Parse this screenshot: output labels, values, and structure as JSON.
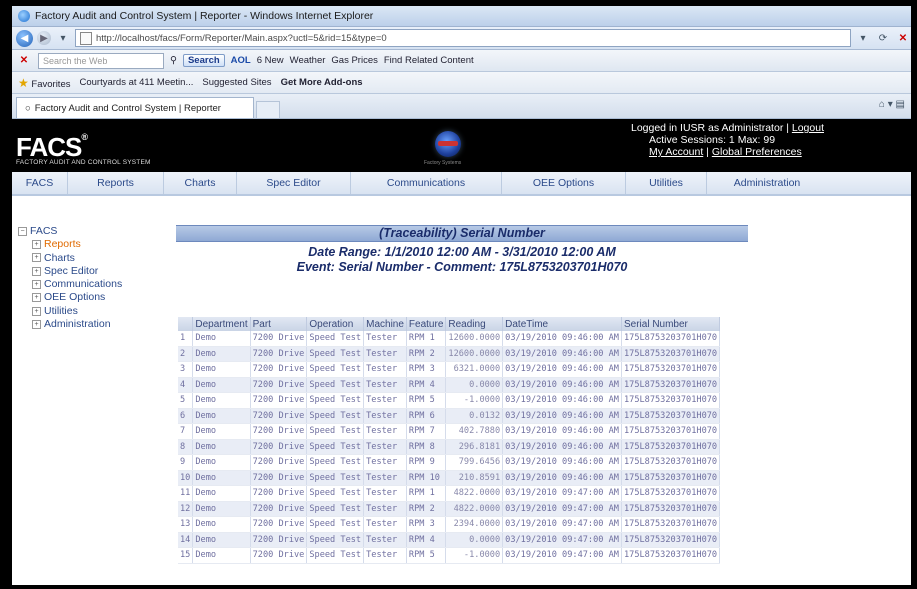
{
  "browser": {
    "title": "Factory Audit and Control System | Reporter - Windows Internet Explorer",
    "url": "http://localhost/facs/Form/Reporter/Main.aspx?uctl=5&rid=15&type=0",
    "search_placeholder": "Search the Web",
    "search_button": "Search",
    "toolbar_items": [
      "AOL",
      "6 New",
      "Weather",
      "Gas Prices",
      "Find Related Content"
    ],
    "favorites_label": "Favorites",
    "favorites_items": [
      "Courtyards at 411 Meetin...",
      "Suggested Sites",
      "Get More Add-ons"
    ],
    "tab_title": "Factory Audit and Control System | Reporter"
  },
  "header": {
    "logo": "FACS",
    "logo_mark": "®",
    "logo_sub": "FACTORY AUDIT AND CONTROL SYSTEM",
    "globe_caption": "Factory Systems",
    "login_prefix": "Logged in IUSR as Administrator | ",
    "logout": "Logout",
    "sessions": "Active Sessions: 1 Max: 99",
    "my_account": "My Account",
    "separator": " | ",
    "global_prefs": "Global Preferences"
  },
  "menu": [
    "FACS",
    "Reports",
    "Charts",
    "Spec Editor",
    "Communications",
    "OEE Options",
    "Utilities",
    "Administration"
  ],
  "tree": {
    "root": "FACS",
    "items": [
      "Reports",
      "Charts",
      "Spec Editor",
      "Communications",
      "OEE Options",
      "Utilities",
      "Administration"
    ]
  },
  "report": {
    "title": "(Traceability) Serial Number",
    "date_range": "Date Range: 1/1/2010 12:00 AM - 3/31/2010 12:00 AM",
    "event": "Event: Serial Number - Comment: 175L8753203701H070"
  },
  "table": {
    "columns": [
      "",
      "Department",
      "Part",
      "Operation",
      "Machine",
      "Feature",
      "Reading",
      "DateTime",
      "Serial Number"
    ],
    "rows": [
      [
        "1",
        "Demo",
        "7200 Drive",
        "Speed Test",
        "Tester",
        "RPM 1",
        "12600.0000",
        "03/19/2010 09:46:00 AM",
        "175L8753203701H070"
      ],
      [
        "2",
        "Demo",
        "7200 Drive",
        "Speed Test",
        "Tester",
        "RPM 2",
        "12600.0000",
        "03/19/2010 09:46:00 AM",
        "175L8753203701H070"
      ],
      [
        "3",
        "Demo",
        "7200 Drive",
        "Speed Test",
        "Tester",
        "RPM 3",
        "6321.0000",
        "03/19/2010 09:46:00 AM",
        "175L8753203701H070"
      ],
      [
        "4",
        "Demo",
        "7200 Drive",
        "Speed Test",
        "Tester",
        "RPM 4",
        "0.0000",
        "03/19/2010 09:46:00 AM",
        "175L8753203701H070"
      ],
      [
        "5",
        "Demo",
        "7200 Drive",
        "Speed Test",
        "Tester",
        "RPM 5",
        "-1.0000",
        "03/19/2010 09:46:00 AM",
        "175L8753203701H070"
      ],
      [
        "6",
        "Demo",
        "7200 Drive",
        "Speed Test",
        "Tester",
        "RPM 6",
        "0.0132",
        "03/19/2010 09:46:00 AM",
        "175L8753203701H070"
      ],
      [
        "7",
        "Demo",
        "7200 Drive",
        "Speed Test",
        "Tester",
        "RPM 7",
        "402.7880",
        "03/19/2010 09:46:00 AM",
        "175L8753203701H070"
      ],
      [
        "8",
        "Demo",
        "7200 Drive",
        "Speed Test",
        "Tester",
        "RPM 8",
        "296.8181",
        "03/19/2010 09:46:00 AM",
        "175L8753203701H070"
      ],
      [
        "9",
        "Demo",
        "7200 Drive",
        "Speed Test",
        "Tester",
        "RPM 9",
        "799.6456",
        "03/19/2010 09:46:00 AM",
        "175L8753203701H070"
      ],
      [
        "10",
        "Demo",
        "7200 Drive",
        "Speed Test",
        "Tester",
        "RPM 10",
        "210.8591",
        "03/19/2010 09:46:00 AM",
        "175L8753203701H070"
      ],
      [
        "11",
        "Demo",
        "7200 Drive",
        "Speed Test",
        "Tester",
        "RPM 1",
        "4822.0000",
        "03/19/2010 09:47:00 AM",
        "175L8753203701H070"
      ],
      [
        "12",
        "Demo",
        "7200 Drive",
        "Speed Test",
        "Tester",
        "RPM 2",
        "4822.0000",
        "03/19/2010 09:47:00 AM",
        "175L8753203701H070"
      ],
      [
        "13",
        "Demo",
        "7200 Drive",
        "Speed Test",
        "Tester",
        "RPM 3",
        "2394.0000",
        "03/19/2010 09:47:00 AM",
        "175L8753203701H070"
      ],
      [
        "14",
        "Demo",
        "7200 Drive",
        "Speed Test",
        "Tester",
        "RPM 4",
        "0.0000",
        "03/19/2010 09:47:00 AM",
        "175L8753203701H070"
      ],
      [
        "15",
        "Demo",
        "7200 Drive",
        "Speed Test",
        "Tester",
        "RPM 5",
        "-1.0000",
        "03/19/2010 09:47:00 AM",
        "175L8753203701H070"
      ]
    ]
  }
}
